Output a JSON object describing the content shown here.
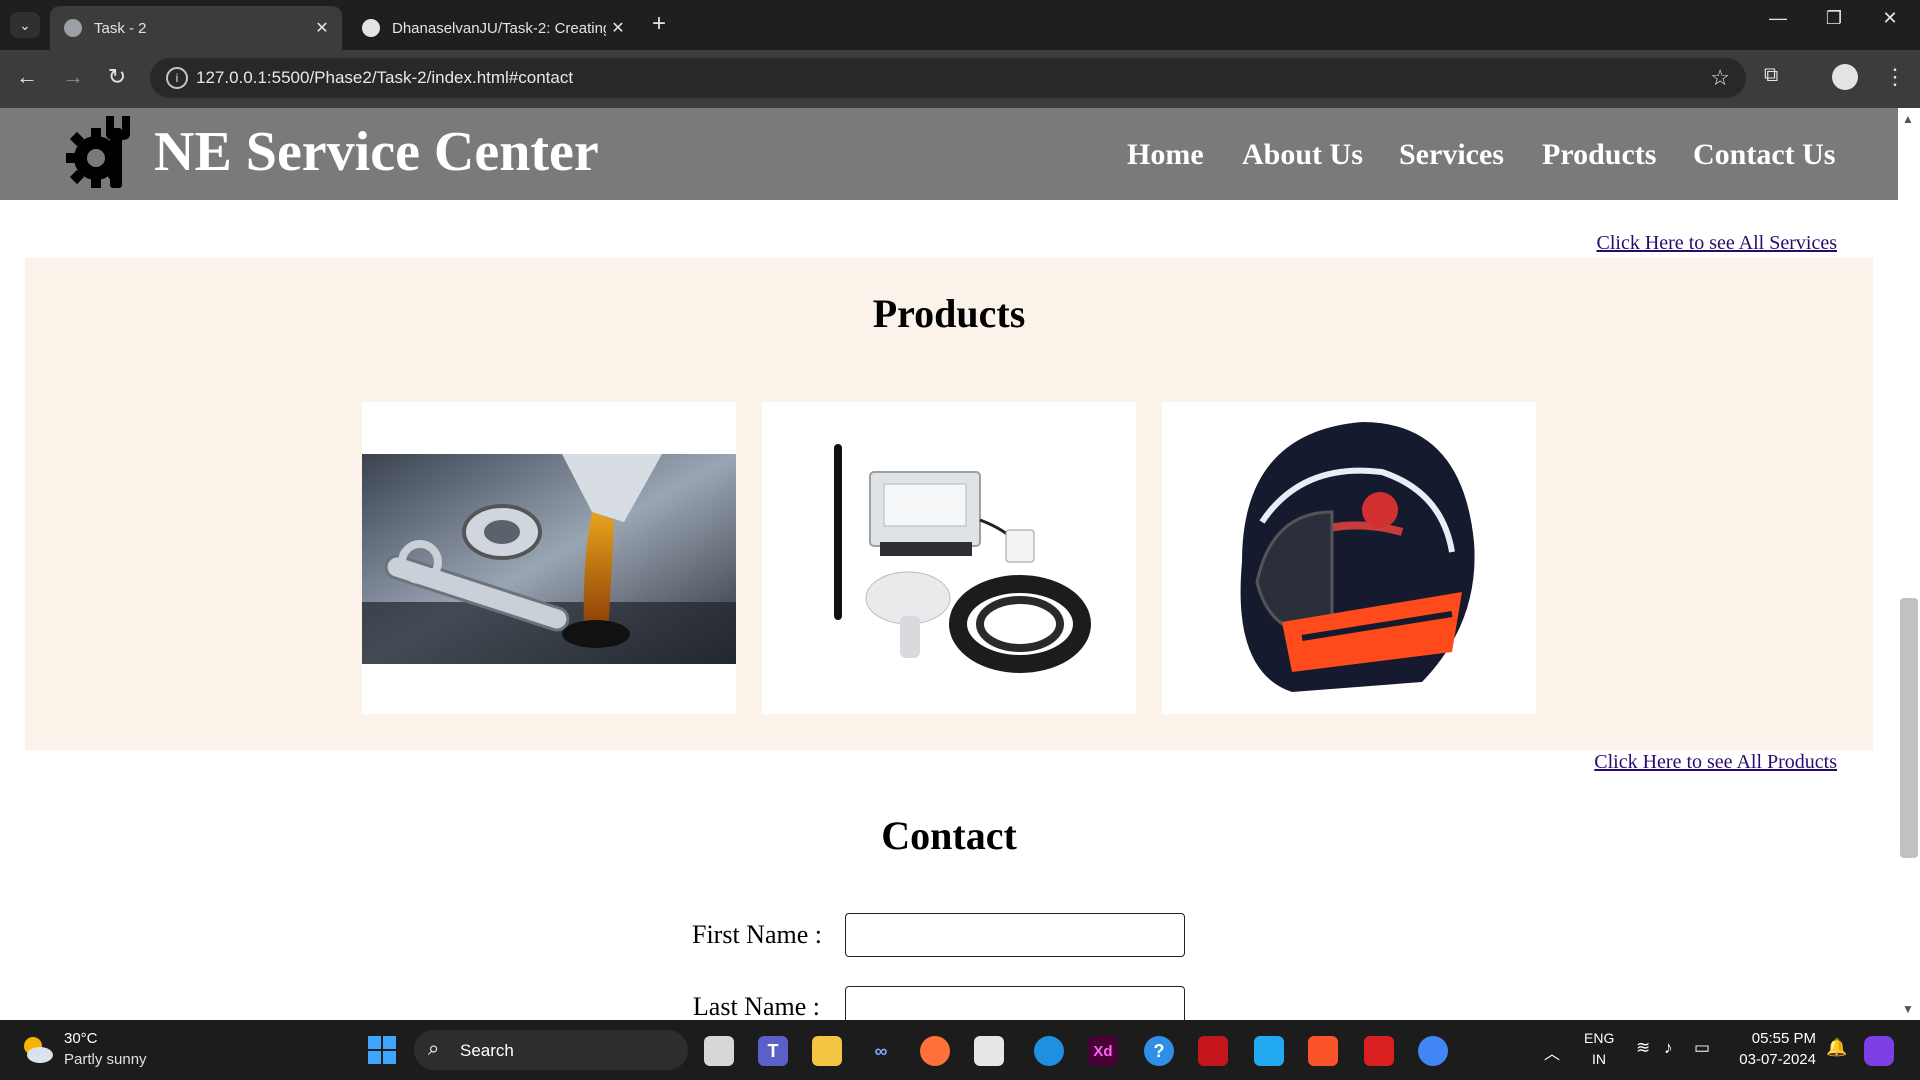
{
  "browser": {
    "tabs": [
      {
        "title": "Task - 2",
        "active": true
      },
      {
        "title": "DhanaselvanJU/Task-2: Creating",
        "active": false
      }
    ],
    "url": "127.0.0.1:5500/Phase2/Task-2/index.html#contact",
    "new_tab_symbol": "+",
    "tab_close_symbol": "✕"
  },
  "site": {
    "brand": "NE Service Center",
    "nav": [
      "Home",
      "About Us",
      "Services",
      "Products",
      "Contact Us"
    ],
    "services_link": "Click Here to see All Services",
    "products_heading": "Products",
    "products": [
      {
        "name": "engine-oil-image"
      },
      {
        "name": "gps-tracker-image"
      },
      {
        "name": "helmet-image"
      }
    ],
    "products_link": "Click Here to see All Products",
    "contact_heading": "Contact",
    "form": {
      "first_name_label": "First Name :",
      "last_name_label": "Last Name :",
      "first_name_value": "",
      "last_name_value": ""
    }
  },
  "taskbar": {
    "weather_temp": "30°C",
    "weather_cond": "Partly sunny",
    "search_label": "Search",
    "lang_line1": "ENG",
    "lang_line2": "IN",
    "time": "05:55 PM",
    "date": "03-07-2024"
  },
  "colors": {
    "nav_bg": "#7a7a7a",
    "products_bg": "#fbf3ea",
    "link": "#2a0a6e"
  }
}
